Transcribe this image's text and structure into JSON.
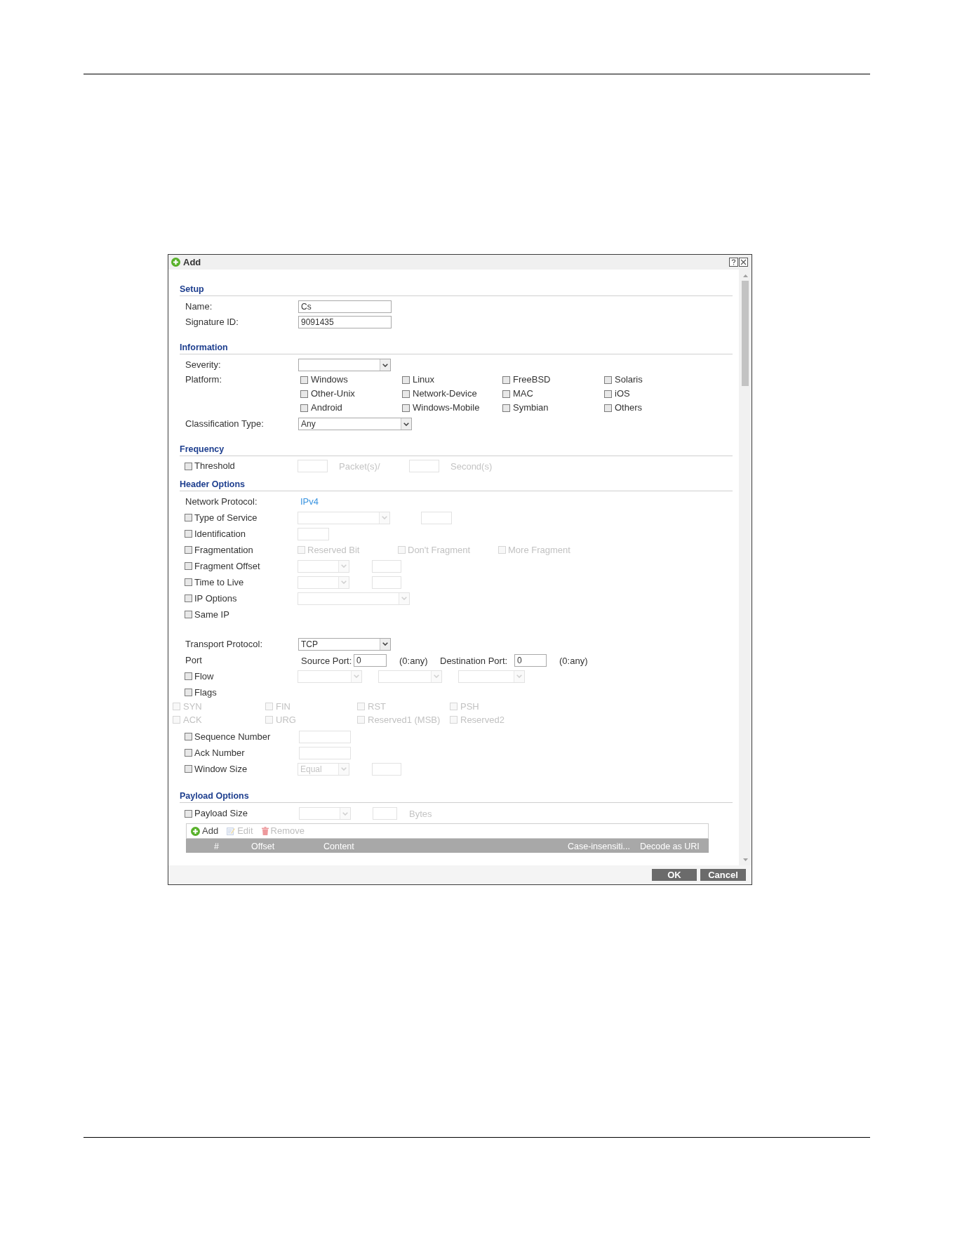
{
  "dialog": {
    "title": "Add"
  },
  "setup": {
    "heading": "Setup",
    "fields": [
      {
        "label": "Name:",
        "value": "Cs"
      },
      {
        "label": "Signature ID:",
        "value": "9091435"
      }
    ]
  },
  "information": {
    "heading": "Information",
    "severity": {
      "label": "Severity:"
    },
    "platform": {
      "label": "Platform:",
      "options": [
        {
          "label": "Windows",
          "checked": false
        },
        {
          "label": "Linux",
          "checked": false
        },
        {
          "label": "FreeBSD",
          "checked": false
        },
        {
          "label": "Solaris",
          "checked": false
        },
        {
          "label": "Other-Unix",
          "checked": false
        },
        {
          "label": "Network-Device",
          "checked": false
        },
        {
          "label": "MAC",
          "checked": false
        },
        {
          "label": "iOS",
          "checked": false
        },
        {
          "label": "Android",
          "checked": false
        },
        {
          "label": "Windows-Mobile",
          "checked": false
        },
        {
          "label": "Symbian",
          "checked": false
        },
        {
          "label": "Others",
          "checked": false
        }
      ]
    },
    "classification": {
      "label": "Classification Type:",
      "value": "Any"
    }
  },
  "frequency": {
    "heading": "Frequency",
    "threshold": {
      "label": "Threshold",
      "checked": false,
      "inputs_disabled": true,
      "packets_unit": "Packet(s)/",
      "seconds_unit": "Second(s)"
    }
  },
  "header_options": {
    "heading": "Header Options",
    "rows": [
      {
        "kind": "info",
        "label": "Network Protocol:",
        "value": "IPv4"
      },
      {
        "kind": "select_input",
        "label": "Type of Service",
        "checked": false,
        "inputs_disabled": true
      },
      {
        "kind": "input",
        "label": "Identification",
        "checked": false,
        "inputs_disabled": true
      },
      {
        "kind": "options",
        "label": "Fragmentation",
        "checked": false,
        "options": [
          {
            "label": "Reserved Bit",
            "checked": false,
            "disabled": true
          },
          {
            "label": "Don't Fragment",
            "checked": false,
            "disabled": true
          },
          {
            "label": "More Fragment",
            "checked": false,
            "disabled": true
          }
        ]
      },
      {
        "kind": "short_select_input",
        "label": "Fragment Offset",
        "checked": false,
        "inputs_disabled": true
      },
      {
        "kind": "short_select_input",
        "label": "Time to Live",
        "checked": false,
        "inputs_disabled": true
      },
      {
        "kind": "select",
        "label": "IP Options",
        "checked": false,
        "inputs_disabled": true
      },
      {
        "kind": "plain",
        "label": "Same IP",
        "checked": false
      },
      {
        "kind": "protocol",
        "label": "Transport Protocol:",
        "value": "TCP"
      },
      {
        "kind": "port",
        "label": "Port",
        "source_label": "Source Port:",
        "source_value": "0",
        "source_hint": "(0:any)",
        "destination_label": "Destination Port:",
        "destination_value": "0",
        "destination_hint": "(0:any)"
      },
      {
        "kind": "selects",
        "label": "Flow",
        "checked": false,
        "inputs_disabled": true
      },
      {
        "kind": "plain",
        "label": "Flags",
        "checked": false
      },
      {
        "kind": "flag_grid",
        "options": [
          {
            "label": "SYN",
            "checked": false,
            "disabled": true
          },
          {
            "label": "FIN",
            "checked": false,
            "disabled": true
          },
          {
            "label": "RST",
            "checked": false,
            "disabled": true
          },
          {
            "label": "PSH",
            "checked": false,
            "disabled": true
          },
          {
            "label": "ACK",
            "checked": false,
            "disabled": true
          },
          {
            "label": "URG",
            "checked": false,
            "disabled": true
          },
          {
            "label": "Reserved1 (MSB)",
            "checked": false,
            "disabled": true
          },
          {
            "label": "Reserved2",
            "checked": false,
            "disabled": true
          }
        ]
      },
      {
        "kind": "wide_input",
        "label": "Sequence Number",
        "checked": false,
        "inputs_disabled": true
      },
      {
        "kind": "wide_input",
        "label": "Ack Number",
        "checked": false,
        "inputs_disabled": true
      },
      {
        "kind": "short_select_input",
        "label": "Window Size",
        "checked": false,
        "inputs_disabled": true,
        "select_value": "Equal"
      }
    ]
  },
  "payload_options": {
    "heading": "Payload Options",
    "payload_size": {
      "label": "Payload Size",
      "checked": false,
      "inputs_disabled": true,
      "unit": "Bytes"
    },
    "toolbar": [
      {
        "kind": "add",
        "label": "Add",
        "disabled": false
      },
      {
        "kind": "edit",
        "label": "Edit",
        "disabled": true
      },
      {
        "kind": "remove",
        "label": "Remove",
        "disabled": true
      }
    ],
    "table": {
      "columns": [
        "#",
        "Offset",
        "Content",
        "Case-insensiti...",
        "Decode as URI"
      ]
    }
  },
  "buttons": [
    "OK",
    "Cancel"
  ]
}
